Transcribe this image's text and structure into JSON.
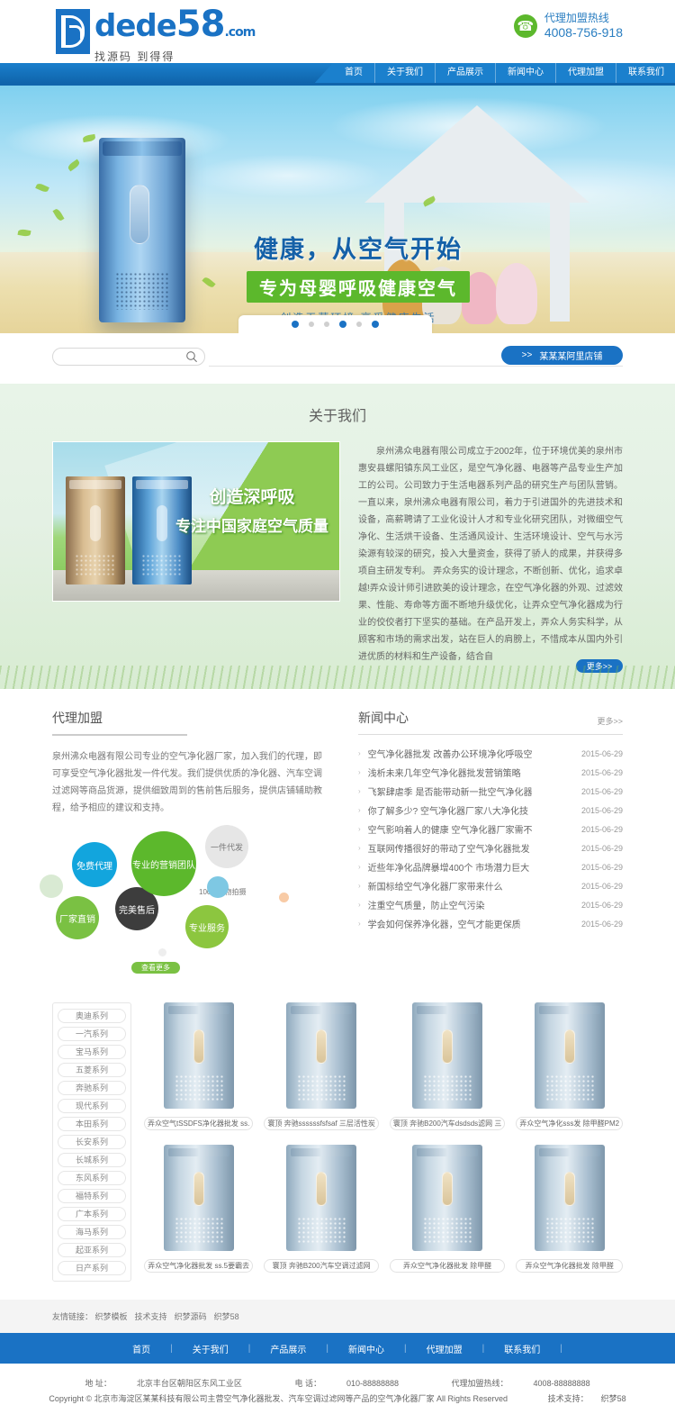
{
  "header": {
    "logo_main": "dede",
    "logo_num": "58",
    "logo_domain": ".com",
    "logo_sub": "找源码 到得得",
    "hotline_label": "代理加盟热线",
    "hotline_number": "4008-756-918"
  },
  "nav": {
    "items": [
      {
        "label": "首页"
      },
      {
        "label": "关于我们"
      },
      {
        "label": "产品展示"
      },
      {
        "label": "新闻中心"
      },
      {
        "label": "代理加盟"
      },
      {
        "label": "联系我们"
      }
    ]
  },
  "banner": {
    "headline": "健康，从空气开始",
    "subhead": "专为母婴呼吸健康空气",
    "tagline": "创造无菌环境 享受健康生活",
    "dots": 6,
    "active_dot": 1
  },
  "search": {
    "placeholder": "",
    "value": "",
    "icon": "search-icon",
    "shop_button": "某某某阿里店铺",
    "shop_button_prefix": ">>"
  },
  "about": {
    "title": "关于我们",
    "image_title": "创造深呼吸",
    "image_subtitle": "专注中国家庭空气质量",
    "body": "泉州沸众电器有限公司成立于2002年，位于环境优美的泉州市惠安县螺阳镇东风工业区，是空气净化器、电器等产品专业生产加工的公司。公司致力于生活电器系列产品的研究生产与团队营销。 一直以来，泉州沸众电器有限公司，着力于引进国外的先进技术和设备，高薪聘请了工业化设计人才和专业化研究团队，对微细空气净化、生活烘干设备、生活通风设计、生活环境设计、空气与水污染源有较深的研究，投入大量资金，获得了骄人的成果，并获得多项自主研发专利。 弄众务实的设计理念，不断创新、优化，追求卓越!弄众设计师引进欧美的设计理念，在空气净化器的外观、过滤效果、性能、寿命等方面不断地升级优化，让弄众空气净化器成为行业的佼佼者打下坚实的基础。在产品开发上，弄众人务实科学，从顾客和市场的需求出发，站在巨人的肩膀上，不惜成本从国内外引进优质的材料和生产设备，结合自",
    "more_label": "更多>>"
  },
  "agent": {
    "title": "代理加盟",
    "desc": "泉州沸众电器有限公司专业的空气净化器厂家，加入我们的代理，即可享受空气净化器批发一件代发。我们提供优质的净化器、汽车空调过滤网等商品货源，提供细致周到的售前售后服务，提供店铺辅助教程，给予相应的建议和支持。",
    "bubbles": [
      {
        "label": "免费代理",
        "color": "#12a5dd"
      },
      {
        "label": "专业的营销团队",
        "color": "#5cb82c"
      },
      {
        "label": "一件代发",
        "color": "#e6e6e6"
      },
      {
        "label": "厂家直销",
        "color": "#7ac143"
      },
      {
        "label": "完美售后",
        "color": "#3d3d3d"
      },
      {
        "label": "专业服务",
        "color": "#8cc63f"
      },
      {
        "label": "100%实物拍摄",
        "color": "#777777"
      }
    ],
    "view_more": "查看更多"
  },
  "news": {
    "title": "新闻中心",
    "more_label": "更多>>",
    "items": [
      {
        "title": "空气净化器批发 改善办公环境净化呼吸空",
        "date": "2015-06-29"
      },
      {
        "title": "浅析未来几年空气净化器批发营销策略",
        "date": "2015-06-29"
      },
      {
        "title": "飞絮肆虐季 是否能带动新一批空气净化器",
        "date": "2015-06-29"
      },
      {
        "title": "你了解多少? 空气净化器厂家八大净化技",
        "date": "2015-06-29"
      },
      {
        "title": "空气影响着人的健康 空气净化器厂家需不",
        "date": "2015-06-29"
      },
      {
        "title": "互联网传播很好的带动了空气净化器批发",
        "date": "2015-06-29"
      },
      {
        "title": "近些年净化品牌暴增400个 市场潜力巨大",
        "date": "2015-06-29"
      },
      {
        "title": "新国标给空气净化器厂家带来什么",
        "date": "2015-06-29"
      },
      {
        "title": "注重空气质量，防止空气污染",
        "date": "2015-06-29"
      },
      {
        "title": "学会如何保养净化器，空气才能更保质",
        "date": "2015-06-29"
      }
    ]
  },
  "products": {
    "categories": [
      "奥迪系列",
      "一汽系列",
      "宝马系列",
      "五菱系列",
      "奔驰系列",
      "现代系列",
      "本田系列",
      "长安系列",
      "长城系列",
      "东风系列",
      "福特系列",
      "广本系列",
      "海马系列",
      "起亚系列",
      "日产系列"
    ],
    "items": [
      {
        "name": "弄众空气tSSDFS净化器批发 ss."
      },
      {
        "name": "寰顶 奔驰ssssssfsfsaf 三层活性炭"
      },
      {
        "name": "寰顶 奔驰B200汽车dsdsds滤网 三"
      },
      {
        "name": "弄众空气净化sss发 除甲醛PM2"
      },
      {
        "name": "弄众空气净化器批发 ss.5要霸去"
      },
      {
        "name": "寰顶 奔驰B200汽车空调过滤网"
      },
      {
        "name": "弄众空气净化器批发 除甲醛"
      },
      {
        "name": "弄众空气净化器批发 除甲醛"
      }
    ]
  },
  "footer": {
    "friend_links_label": "友情链接：",
    "friend_links": [
      "织梦模板",
      "技术支持",
      "织梦源码",
      "织梦58"
    ],
    "nav": [
      "首页",
      "关于我们",
      "产品展示",
      "新闻中心",
      "代理加盟",
      "联系我们"
    ],
    "address_label": "地 址：",
    "address": "北京丰台区朝阳区东风工业区",
    "phone_label": "电 话：",
    "phone": "010-88888888",
    "agent_hotline_label": "代理加盟热线：",
    "agent_hotline": "4008-88888888",
    "copyright": "Copyright © 北京市海淀区某某科技有限公司主营空气净化器批发、汽车空调过滤网等产品的空气净化器厂家 All Rights Reserved",
    "tech_label": "技术支持：",
    "tech_value": "织梦58"
  }
}
